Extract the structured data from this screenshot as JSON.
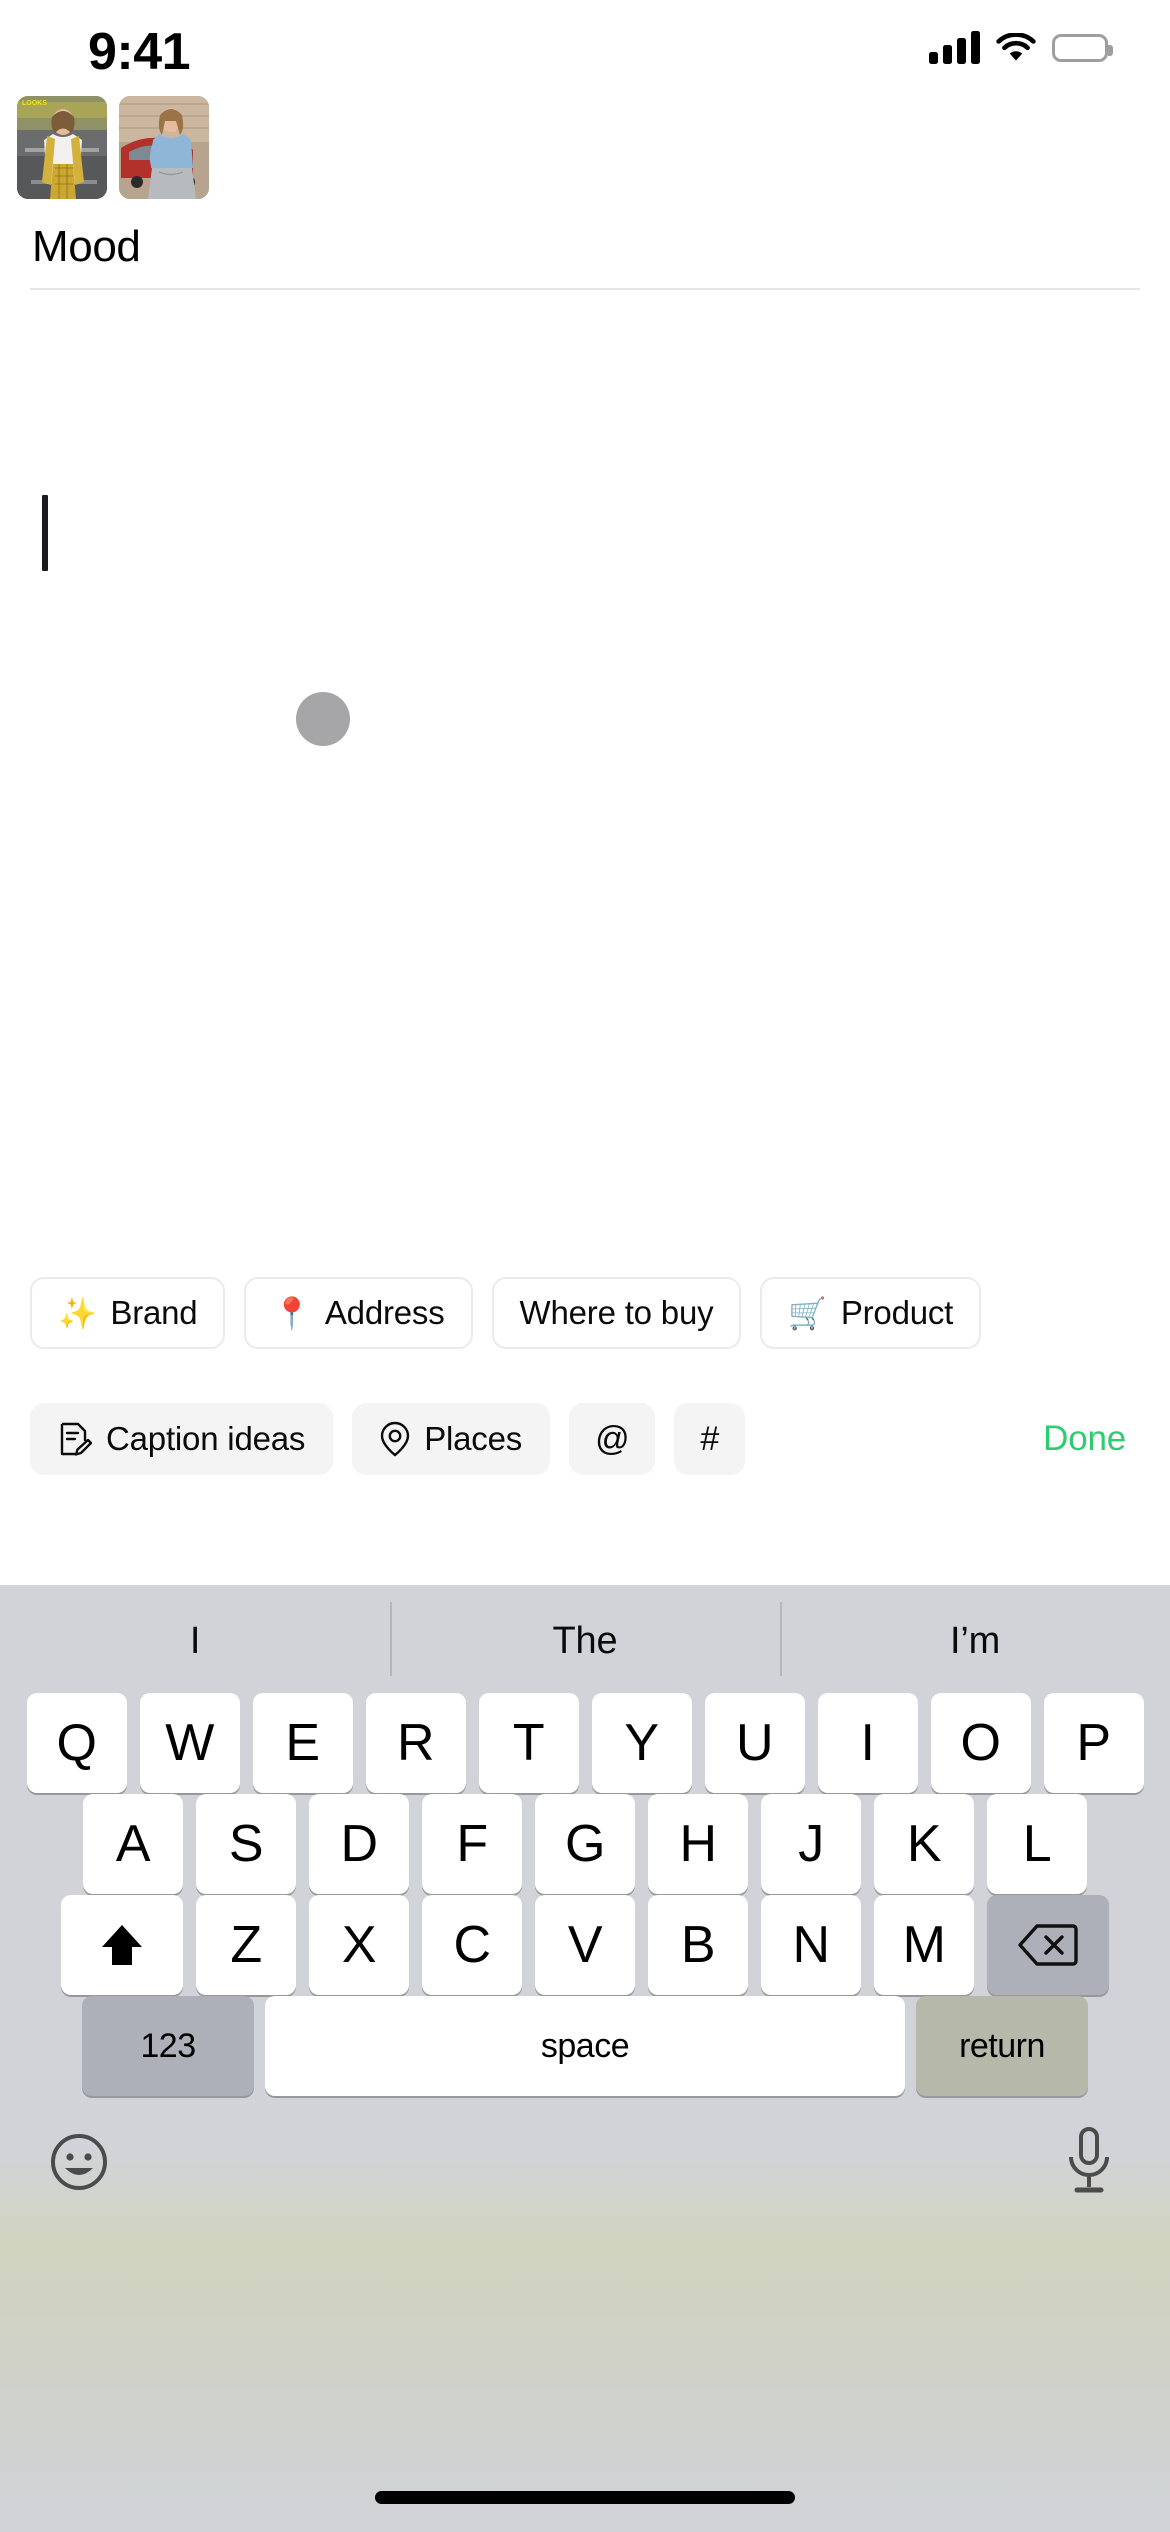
{
  "status_bar": {
    "time": "9:41",
    "cellular_icon": "signal-bars-icon",
    "wifi_icon": "wifi-icon",
    "battery_icon": "battery-full-icon"
  },
  "composer": {
    "thumbnails": [
      {
        "name": "thumbnail-1",
        "alt": "Woman in gold plaid suit on street",
        "overlay_text": "LOOKS"
      },
      {
        "name": "thumbnail-2",
        "alt": "Woman in blue turtleneck by red car"
      }
    ],
    "title": "Mood",
    "caption_value": "",
    "caption_placeholder": ""
  },
  "suggestion_rows": {
    "row1": [
      {
        "label": "Brand",
        "icon": "sparkles-emoji",
        "glyph": "✨",
        "style": "outlined"
      },
      {
        "label": "Address",
        "icon": "pin-emoji",
        "glyph": "📍",
        "style": "outlined"
      },
      {
        "label": "Where to buy",
        "icon": "none",
        "glyph": "",
        "style": "outlined"
      },
      {
        "label": "Product",
        "icon": "shopping-cart-emoji",
        "glyph": "🛒",
        "style": "outlined"
      }
    ],
    "row2": [
      {
        "label": "Caption ideas",
        "icon": "note-pencil-icon",
        "style": "filled"
      },
      {
        "label": "Places",
        "icon": "location-pin-icon",
        "style": "filled"
      },
      {
        "label": "@",
        "icon": "at-sign-icon",
        "style": "filled"
      },
      {
        "label": "#",
        "icon": "hashtag-icon",
        "style": "filled"
      }
    ],
    "done_label": "Done",
    "done_color": "#2ecc71"
  },
  "keyboard": {
    "predictions": [
      "I",
      "The",
      "I’m"
    ],
    "row1": [
      "Q",
      "W",
      "E",
      "R",
      "T",
      "Y",
      "U",
      "I",
      "O",
      "P"
    ],
    "row2": [
      "A",
      "S",
      "D",
      "F",
      "G",
      "H",
      "J",
      "K",
      "L"
    ],
    "row3": [
      "Z",
      "X",
      "C",
      "V",
      "B",
      "N",
      "M"
    ],
    "shift_icon": "shift-arrow-icon",
    "backspace_icon": "backspace-icon",
    "numbers_label": "123",
    "space_label": "space",
    "return_label": "return",
    "emoji_icon": "emoji-smiley-icon",
    "dictation_icon": "microphone-icon"
  },
  "home_indicator": "home-indicator"
}
